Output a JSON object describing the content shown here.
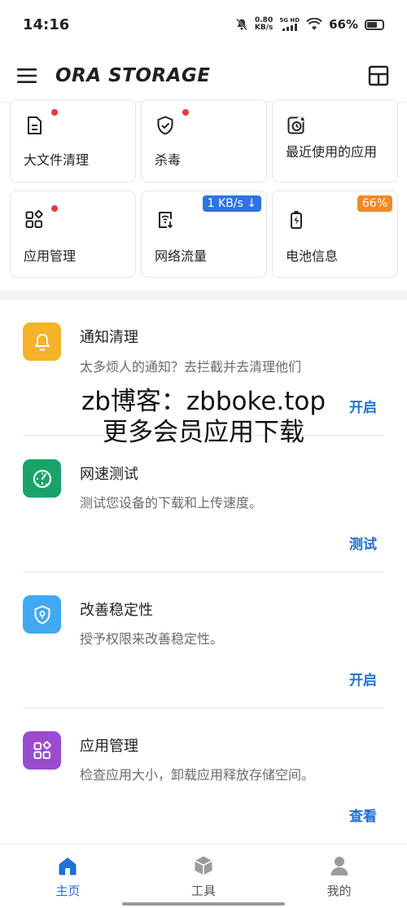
{
  "status_bar": {
    "time": "14:16",
    "net_speed_value": "0.80",
    "net_speed_unit": "KB/s",
    "signal_tag": "5G HD",
    "battery": "66%"
  },
  "app_bar": {
    "title": "ORA STORAGE"
  },
  "tiles": [
    {
      "label": "大文件清理",
      "icon": "file-document-icon",
      "dot": true
    },
    {
      "label": "杀毒",
      "icon": "shield-check-icon",
      "dot": true
    },
    {
      "label": "最近使用的应用",
      "icon": "recent-clock-icon",
      "dot": false
    },
    {
      "label": "应用管理",
      "icon": "apps-grid-icon",
      "dot": true
    },
    {
      "label": "网络流量",
      "icon": "network-traffic-icon",
      "badge": "1 KB/s ↓"
    },
    {
      "label": "电池信息",
      "icon": "battery-charging-icon",
      "badge": "66%"
    }
  ],
  "items": [
    {
      "title": "通知清理",
      "desc": "太多烦人的通知？去拦截并去清理他们",
      "action": "开启",
      "icon": "bell-icon",
      "color": "#f5b32a"
    },
    {
      "title": "网速测试",
      "desc": "测试您设备的下载和上传速度。",
      "action": "测试",
      "icon": "speedometer-icon",
      "color": "#18a468"
    },
    {
      "title": "改善稳定性",
      "desc": "授予权限来改善稳定性。",
      "action": "开启",
      "icon": "shield-location-icon",
      "color": "#41a9f2"
    },
    {
      "title": "应用管理",
      "desc": "检查应用大小，卸载应用释放存储空间。",
      "action": "查看",
      "icon": "apps-grid-icon",
      "color": "#9a4bd0"
    }
  ],
  "watermark": {
    "line1": "zb博客：zbboke.top",
    "line2": "更多会员应用下载"
  },
  "nav": [
    {
      "label": "主页",
      "icon": "home-icon",
      "active": true
    },
    {
      "label": "工具",
      "icon": "toolbox-cube-icon",
      "active": false
    },
    {
      "label": "我的",
      "icon": "person-icon",
      "active": false
    }
  ],
  "colors": {
    "accent": "#1f6fd6",
    "badge_blue": "#2e73e6",
    "badge_orange": "#f08a24",
    "dot_red": "#e8393f"
  }
}
